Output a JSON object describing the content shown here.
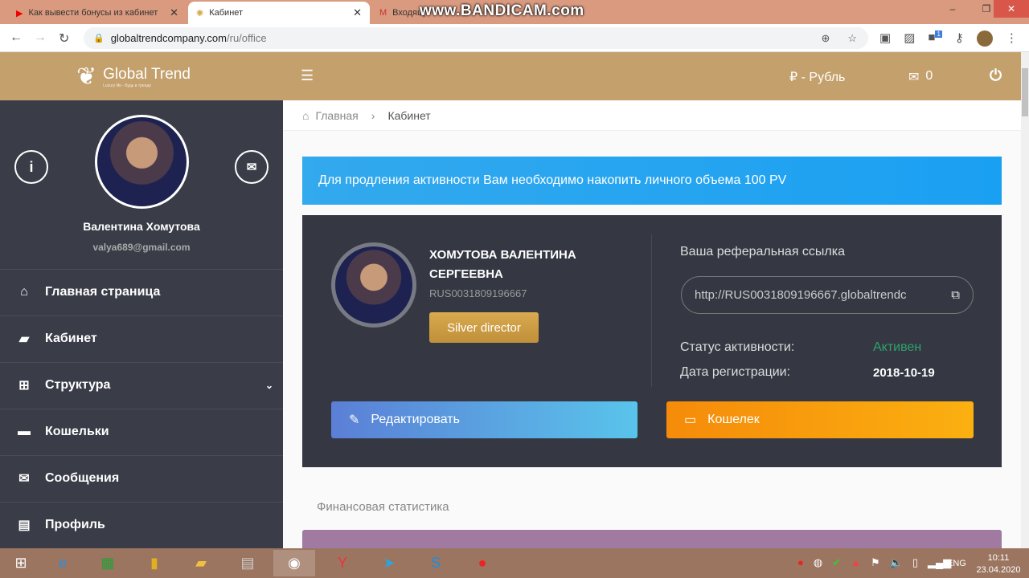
{
  "browser": {
    "tabs": [
      {
        "title": "Как вывести бонусы из кабинет",
        "icon": "youtube-icon"
      },
      {
        "title": "Кабинет",
        "icon": "globaltrend-icon"
      },
      {
        "title": "Входящ",
        "icon": "gmail-icon"
      }
    ],
    "url_host": "globaltrendcompany.com",
    "url_path": "/ru/office",
    "extension_badge": "1"
  },
  "watermark": "www.BANDICAM.com",
  "header": {
    "logo_title": "Global Trend",
    "logo_tagline": "Luxury life - Будь в тренде",
    "currency": "₽ - Рубль",
    "messages_count": "0"
  },
  "sidebar": {
    "user_name": "Валентина Хомутова",
    "user_email": "valya689@gmail.com",
    "items": [
      {
        "label": "Главная страница",
        "icon": "home-icon"
      },
      {
        "label": "Кабинет",
        "icon": "briefcase-icon"
      },
      {
        "label": "Структура",
        "icon": "sitemap-icon"
      },
      {
        "label": "Кошельки",
        "icon": "credit-card-icon"
      },
      {
        "label": "Сообщения",
        "icon": "envelope-icon"
      },
      {
        "label": "Профиль",
        "icon": "id-card-icon"
      }
    ]
  },
  "breadcrumb": [
    "Главная",
    "Кабинет"
  ],
  "alert": "Для продления активности Вам необходимо накопить личного объема 100 PV",
  "profile": {
    "full_name_line1": "ХОМУТОВА ВАЛЕНТИНА",
    "full_name_line2": "СЕРГЕЕВНА",
    "id": "RUS0031809196667",
    "rank": "Silver director",
    "ref_label": "Ваша реферальная ссылка",
    "ref_link": "http://RUS0031809196667.globaltrendc",
    "status_label": "Статус активности:",
    "status_value": "Активен",
    "status_color": "#2ea36b",
    "reg_label": "Дата регистрации:",
    "reg_value": "2018-10-19",
    "edit_button": "Редактировать",
    "wallet_button": "Кошелек"
  },
  "section_title": "Финансовая статистика",
  "taskbar": {
    "lang": "ENG",
    "time": "10:11",
    "date": "23.04.2020"
  }
}
